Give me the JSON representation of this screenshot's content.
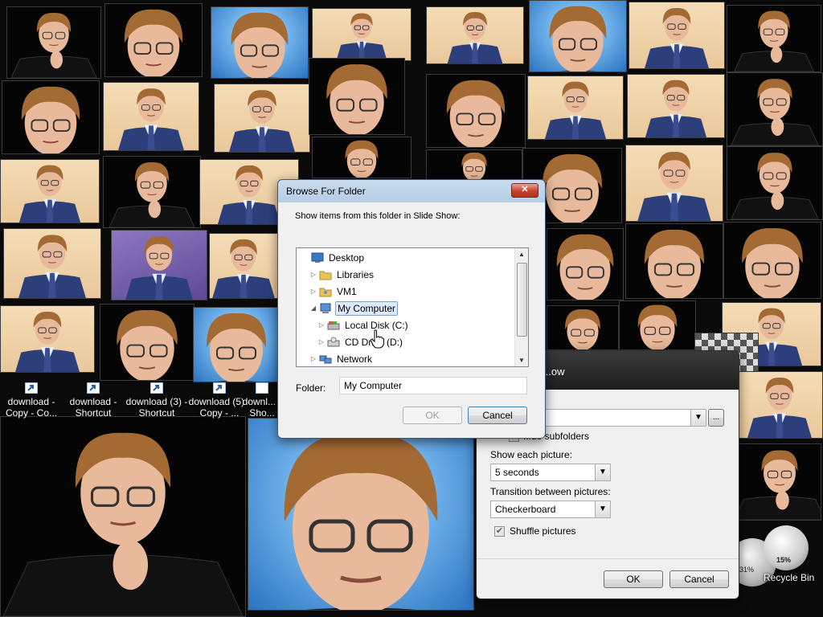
{
  "desktop": {
    "icons": [
      {
        "label": "download - Copy - Co..."
      },
      {
        "label": "download - Shortcut"
      },
      {
        "label": "download (3) - Shortcut"
      },
      {
        "label": "download (5) - Copy - ..."
      },
      {
        "label": "downl... - Sho..."
      }
    ],
    "recycle_bin_label": "Recycle Bin",
    "gadget": {
      "cpu_percent": "15%",
      "mem_percent": "31%"
    }
  },
  "browse_dialog": {
    "title": "Browse For Folder",
    "close_glyph": "✕",
    "instruction": "Show items from this folder in Slide Show:",
    "tree": [
      {
        "label": "Desktop",
        "icon": "desktop-icon",
        "expander": "",
        "indent": 0
      },
      {
        "label": "Libraries",
        "icon": "folder-icon",
        "expander": "▷",
        "indent": 1
      },
      {
        "label": "VM1",
        "icon": "user-folder-icon",
        "expander": "▷",
        "indent": 1
      },
      {
        "label": "My Computer",
        "icon": "computer-icon",
        "expander": "◢",
        "indent": 1,
        "selected": true
      },
      {
        "label": "Local Disk (C:)",
        "icon": "local-disk-icon",
        "expander": "▷",
        "indent": 2
      },
      {
        "label": "CD Drive (D:)",
        "icon": "cd-drive-icon",
        "expander": "▷",
        "indent": 2
      },
      {
        "label": "Network",
        "icon": "network-icon",
        "expander": "▷",
        "indent": 1
      }
    ],
    "folder_label": "Folder:",
    "folder_value": "My Computer",
    "ok_label": "OK",
    "cancel_label": "Cancel"
  },
  "slideshow_settings": {
    "title": "...ow",
    "include_subfolders_label": "...de subfolders",
    "show_each_label": "Show each picture:",
    "show_each_value": "5 seconds",
    "transition_label": "Transition between pictures:",
    "transition_value": "Checkerboard",
    "shuffle_label": "Shuffle pictures",
    "shuffle_checked": true,
    "browse_glyph": "...",
    "ok_label": "OK",
    "cancel_label": "Cancel"
  },
  "colors": {
    "accent_selection": "#dcebfc",
    "title_bar": "#c9dbee",
    "close_button": "#c7432b"
  }
}
